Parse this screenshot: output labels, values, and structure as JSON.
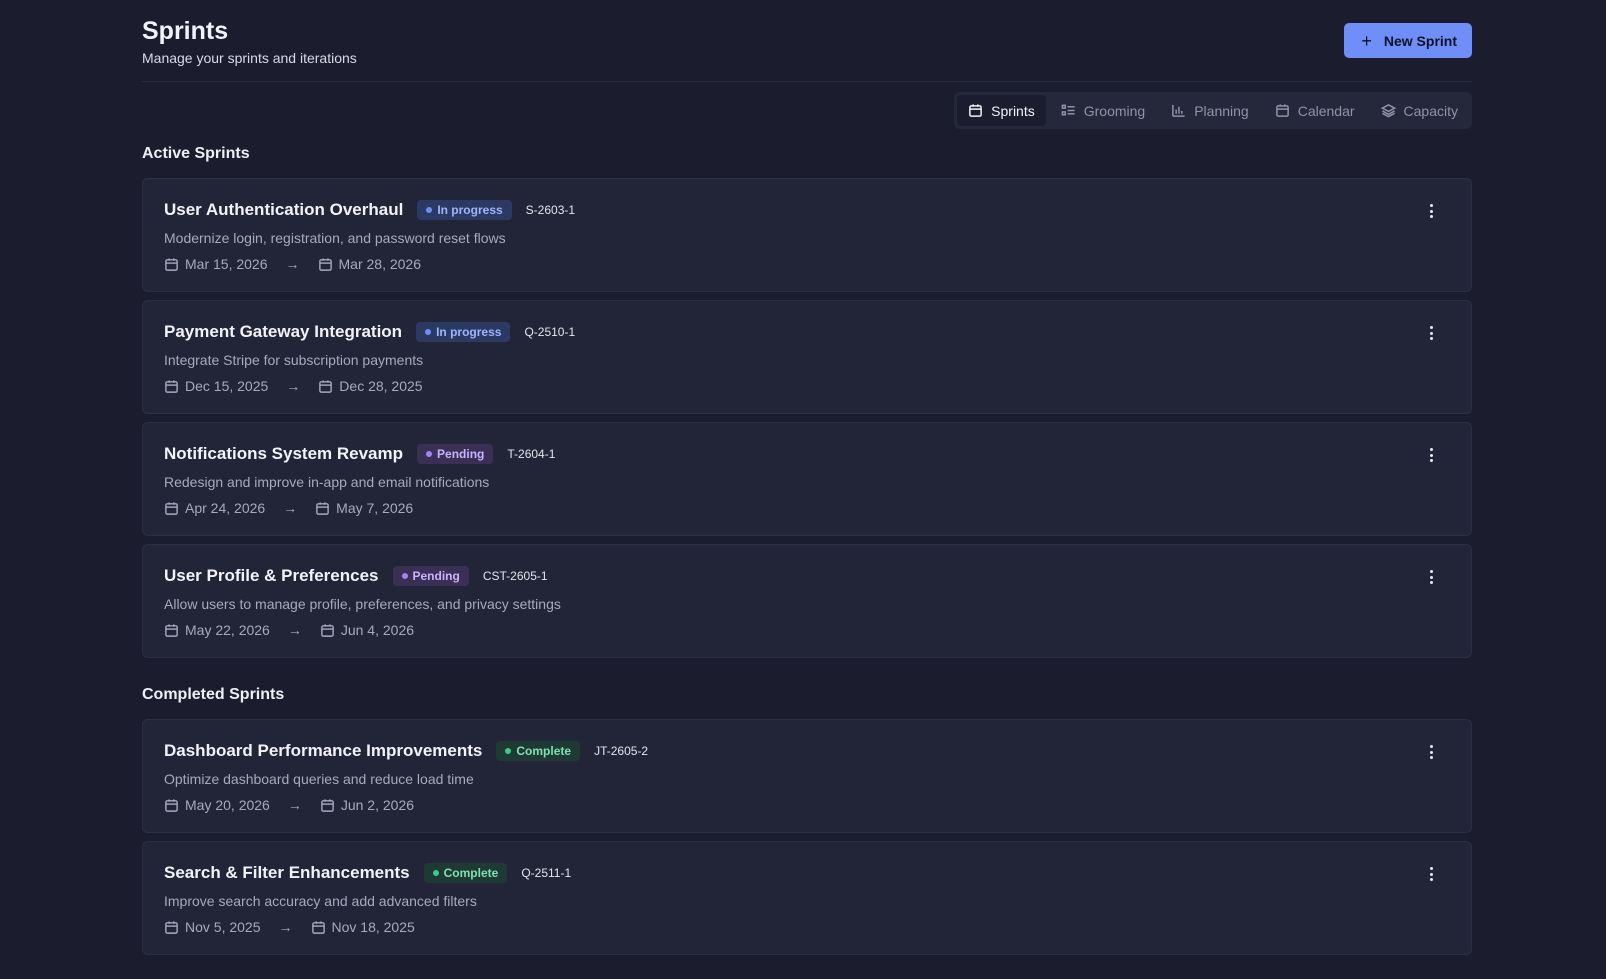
{
  "header": {
    "title": "Sprints",
    "subtitle": "Manage your sprints and iterations",
    "new_button_label": "New Sprint"
  },
  "tabs": [
    {
      "label": "Sprints",
      "icon": "calendar-icon",
      "active": true
    },
    {
      "label": "Grooming",
      "icon": "list-icon",
      "active": false
    },
    {
      "label": "Planning",
      "icon": "bar-chart-icon",
      "active": false
    },
    {
      "label": "Calendar",
      "icon": "calendar-icon",
      "active": false
    },
    {
      "label": "Capacity",
      "icon": "layers-icon",
      "active": false
    }
  ],
  "sections": {
    "active_title": "Active Sprints",
    "completed_title": "Completed Sprints"
  },
  "active_sprints": [
    {
      "title": "User Authentication Overhaul",
      "status": "In progress",
      "status_kind": "progress",
      "code": "S-2603-1",
      "description": "Modernize login, registration, and password reset flows",
      "start": "Mar 15, 2026",
      "end": "Mar 28, 2026"
    },
    {
      "title": "Payment Gateway Integration",
      "status": "In progress",
      "status_kind": "progress",
      "code": "Q-2510-1",
      "description": "Integrate Stripe for subscription payments",
      "start": "Dec 15, 2025",
      "end": "Dec 28, 2025"
    },
    {
      "title": "Notifications System Revamp",
      "status": "Pending",
      "status_kind": "pending",
      "code": "T-2604-1",
      "description": "Redesign and improve in-app and email notifications",
      "start": "Apr 24, 2026",
      "end": "May 7, 2026"
    },
    {
      "title": "User Profile & Preferences",
      "status": "Pending",
      "status_kind": "pending",
      "code": "CST-2605-1",
      "description": "Allow users to manage profile, preferences, and privacy settings",
      "start": "May 22, 2026",
      "end": "Jun 4, 2026"
    }
  ],
  "completed_sprints": [
    {
      "title": "Dashboard Performance Improvements",
      "status": "Complete",
      "status_kind": "complete",
      "code": "JT-2605-2",
      "description": "Optimize dashboard queries and reduce load time",
      "start": "May 20, 2026",
      "end": "Jun 2, 2026"
    },
    {
      "title": "Search & Filter Enhancements",
      "status": "Complete",
      "status_kind": "complete",
      "code": "Q-2511-1",
      "description": "Improve search accuracy and add advanced filters",
      "start": "Nov 5, 2025",
      "end": "Nov 18, 2025"
    }
  ],
  "date_arrow": "→",
  "colors": {
    "background": "#1b1d2e",
    "card": "#222437",
    "accent": "#6f8ef7",
    "in_progress": "#6f8ef7",
    "pending": "#a583f0",
    "complete": "#3fc98a"
  }
}
